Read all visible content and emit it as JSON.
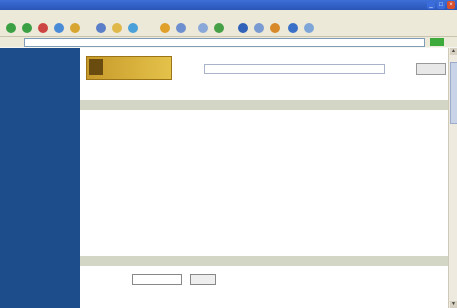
{
  "window": {
    "title": "",
    "controls": [
      "_",
      "□",
      "×"
    ]
  },
  "menu": [
    {
      "label": ""
    },
    {
      "label": ""
    },
    {
      "label": ""
    },
    {
      "label": ""
    },
    {
      "label": ""
    },
    {
      "label": ""
    },
    {
      "label": ""
    },
    {
      "label": ""
    }
  ],
  "toolbar": {
    "icons": [
      "back-icon",
      "forward-icon",
      "stop-icon",
      "refresh-icon",
      "home-icon",
      "search-icon",
      "favorites-icon",
      "history-icon",
      "mail-icon",
      "print-icon"
    ]
  },
  "address": {
    "label": "",
    "value": "",
    "go_label": ""
  },
  "leftnav": {
    "items": [
      "",
      ""
    ]
  },
  "logo": {
    "line1": "",
    "line2": ""
  },
  "search": {
    "value": "",
    "button": ""
  },
  "meta": {
    "label": "",
    "value": ""
  },
  "help": {
    "label": ""
  },
  "result_band_top": {
    "left": "",
    "mid": ""
  },
  "result": {
    "title": "",
    "byline": "",
    "body": "",
    "detail_links": [
      "",
      ""
    ],
    "fields": [
      "",
      ""
    ]
  },
  "result_band_bottom": {
    "left": "",
    "mid": ""
  },
  "pager": {
    "label": "",
    "select": "",
    "button": ""
  },
  "footer": {
    "text": ""
  },
  "colors": {
    "nav": "#1e4d8c",
    "band": "#d3d6c4",
    "logo": "#d8ae38",
    "link": "#1a3fa8"
  }
}
